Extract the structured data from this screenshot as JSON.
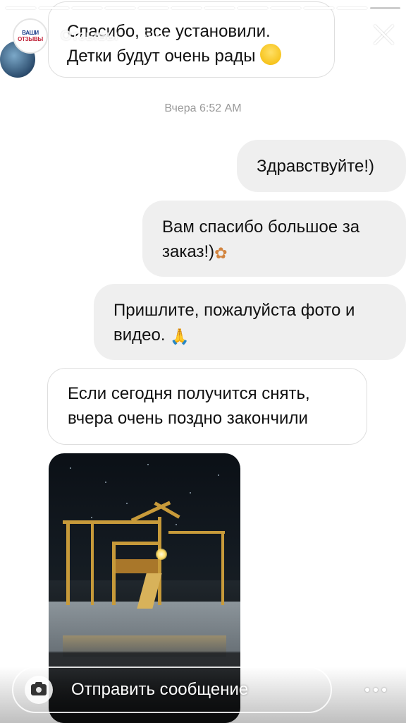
{
  "story": {
    "segments_total": 12,
    "segments_done": 11,
    "header": {
      "avatar_line1": "ВАШИ",
      "avatar_line2": "ОТЗЫВЫ",
      "title": "Отзывы",
      "time": "5нед."
    }
  },
  "chat": {
    "messages": [
      {
        "text_line1": "Спасибо, все установили.",
        "text_line2": "Детки будут очень рады",
        "emoji": "grinning-face"
      },
      {
        "timestamp": "Вчера 6:52 AM"
      },
      {
        "text": "Здравствуйте!)"
      },
      {
        "text_line1": "Вам спасибо большое за",
        "text_line2": "заказ!)",
        "emoji": "bouquet"
      },
      {
        "text_line1": "Пришлите, пожалуйста фото и",
        "text_line2": "видео.",
        "emoji": "folded-hands"
      },
      {
        "text_line1": "Если сегодня получится снять,",
        "text_line2": "вчера очень поздно закончили"
      }
    ]
  },
  "reply": {
    "placeholder": "Отправить сообщение"
  },
  "colors": {
    "incoming_bubble": "#ffffff",
    "outgoing_bubble": "#efefef",
    "timestamp": "#999999"
  }
}
